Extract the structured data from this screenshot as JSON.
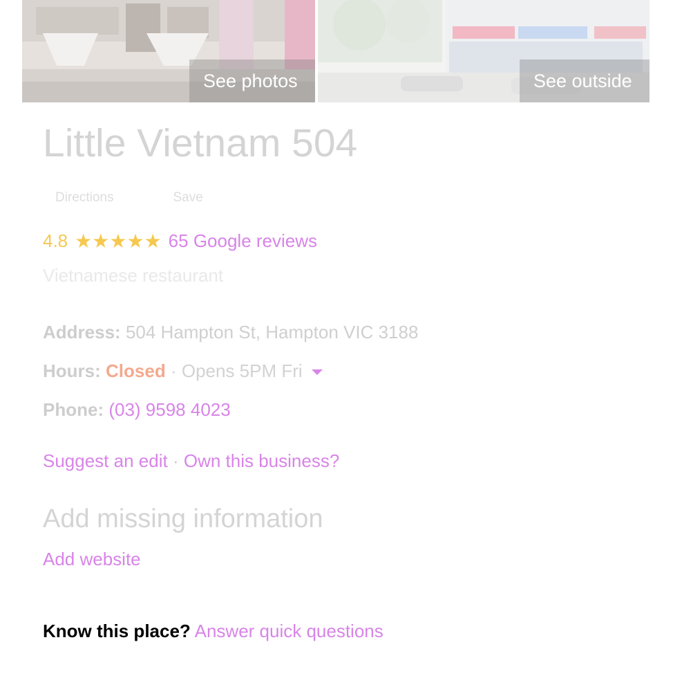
{
  "photos": {
    "left_label": "See photos",
    "right_label": "See outside"
  },
  "place": {
    "title": "Little Vietnam 504",
    "actions": {
      "directions": "Directions",
      "save": "Save"
    },
    "rating": "4.8",
    "stars": "★★★★★",
    "reviews": "65 Google reviews",
    "category": "Vietnamese restaurant"
  },
  "info": {
    "address_label": "Address:",
    "address": "504 Hampton St, Hampton VIC 3188",
    "hours_label": "Hours:",
    "hours_status": "Closed",
    "hours_separator": "·",
    "hours_detail": "Opens 5PM Fri",
    "phone_label": "Phone:",
    "phone": "(03) 9598 4023"
  },
  "edit": {
    "suggest": "Suggest an edit",
    "separator": "·",
    "own": "Own this business?"
  },
  "missing": {
    "title": "Add missing information",
    "add_website": "Add website"
  },
  "know": {
    "label": "Know this place?",
    "link": "Answer quick questions"
  },
  "colors": {
    "link": "#d884e8",
    "star": "#f6c84f",
    "closed": "#f4a98e"
  },
  "icons": {
    "hours_dropdown": "caret-down-icon"
  }
}
